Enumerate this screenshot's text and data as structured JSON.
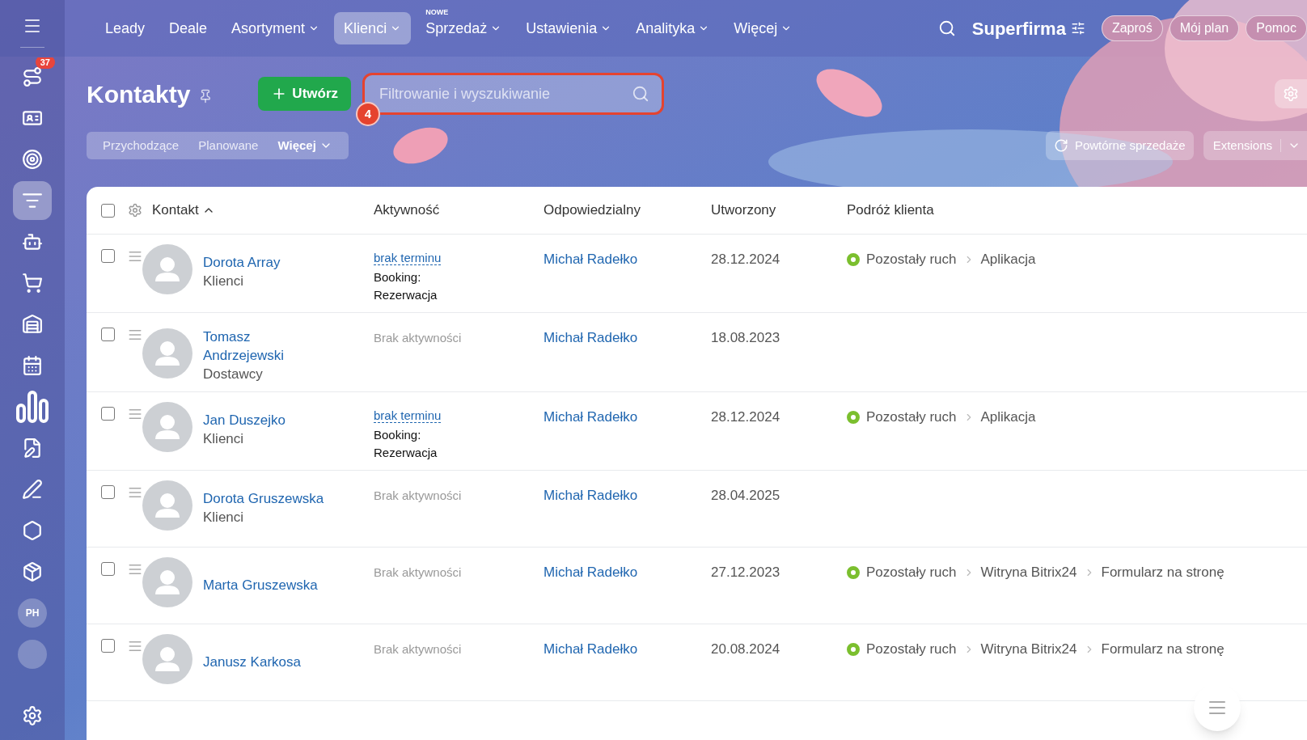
{
  "sidebar": {
    "items": [
      {
        "selected": false,
        "badge": "37"
      },
      {
        "selected": false
      },
      {
        "selected": false
      },
      {
        "selected": true
      },
      {
        "selected": false
      },
      {
        "selected": false
      },
      {
        "selected": false
      },
      {
        "selected": false
      },
      {
        "selected": false
      },
      {
        "selected": false
      },
      {
        "selected": false
      },
      {
        "selected": false
      },
      {
        "selected": false
      },
      {
        "selected": false,
        "kind": "avatar",
        "initials": "PH"
      },
      {
        "selected": false,
        "kind": "avatar"
      }
    ]
  },
  "top_nav": {
    "items": [
      {
        "label": "Leady",
        "selected": false,
        "dropdown": false
      },
      {
        "label": "Deale",
        "selected": false,
        "dropdown": false
      },
      {
        "label": "Asortyment",
        "selected": false,
        "dropdown": true
      },
      {
        "label": "Klienci",
        "selected": true,
        "dropdown": true
      },
      {
        "label": "Sprzedaż",
        "selected": false,
        "dropdown": true,
        "tag": "NOWE"
      },
      {
        "label": "Ustawienia",
        "selected": false,
        "dropdown": true
      },
      {
        "label": "Analityka",
        "selected": false,
        "dropdown": true
      },
      {
        "label": "Więcej",
        "selected": false,
        "dropdown": true
      }
    ],
    "brand": "Superfirma",
    "buttons": [
      "Zaproś",
      "Mój plan",
      "Pomoc"
    ]
  },
  "header": {
    "title": "Kontakty",
    "create_button": "Utwórz",
    "search": {
      "placeholder": "Filtrowanie i wyszukiwanie",
      "highlighted": true,
      "step_badge": "4"
    },
    "filters": [
      {
        "label": "Przychodzące",
        "selected": false
      },
      {
        "label": "Planowane",
        "selected": false
      },
      {
        "label": "Więcej",
        "selected": true,
        "dropdown": true
      }
    ],
    "right_buttons": [
      {
        "label": "Powtórne sprzedaże",
        "kind": "icon"
      },
      {
        "label": "Extensions",
        "kind": "split"
      }
    ]
  },
  "table": {
    "select_all_checked": false,
    "columns": [
      {
        "label": "Kontakt",
        "sort_ascending": true
      },
      {
        "label": "Aktywność"
      },
      {
        "label": "Odpowiedzialny"
      },
      {
        "label": "Utworzony"
      },
      {
        "label": "Podróż klienta"
      }
    ],
    "rows": [
      {
        "checked": false,
        "name": "Dorota Array",
        "type": "Klienci",
        "activity": {
          "kind": "deadline",
          "link": "brak terminu",
          "note": "Booking: Rezerwacja"
        },
        "responsible": "Michał Radełko",
        "created": "28.12.2024",
        "journey": [
          "Pozostały ruch",
          "Aplikacja"
        ]
      },
      {
        "checked": false,
        "name": "Tomasz Andrzejewski",
        "type": "Dostawcy",
        "activity": {
          "kind": "none",
          "text": "Brak aktywności"
        },
        "responsible": "Michał Radełko",
        "created": "18.08.2023",
        "journey": []
      },
      {
        "checked": false,
        "name": "Jan Duszejko",
        "type": "Klienci",
        "activity": {
          "kind": "deadline",
          "link": "brak terminu",
          "note": "Booking: Rezerwacja"
        },
        "responsible": "Michał Radełko",
        "created": "28.12.2024",
        "journey": [
          "Pozostały ruch",
          "Aplikacja"
        ]
      },
      {
        "checked": false,
        "name": "Dorota Gruszewska",
        "type": "Klienci",
        "activity": {
          "kind": "none",
          "text": "Brak aktywności"
        },
        "responsible": "Michał Radełko",
        "created": "28.04.2025",
        "journey": []
      },
      {
        "checked": false,
        "name": "Marta Gruszewska",
        "activity": {
          "kind": "none",
          "text": "Brak aktywności"
        },
        "responsible": "Michał Radełko",
        "created": "27.12.2023",
        "journey": [
          "Pozostały ruch",
          "Witryna Bitrix24",
          "Formularz na stronę"
        ]
      },
      {
        "checked": false,
        "name": "Janusz Karkosa",
        "activity": {
          "kind": "none",
          "text": "Brak aktywności"
        },
        "responsible": "Michał Radełko",
        "created": "20.08.2024",
        "journey": [
          "Pozostały ruch",
          "Witryna Bitrix24",
          "Formularz na stronę"
        ]
      }
    ]
  }
}
